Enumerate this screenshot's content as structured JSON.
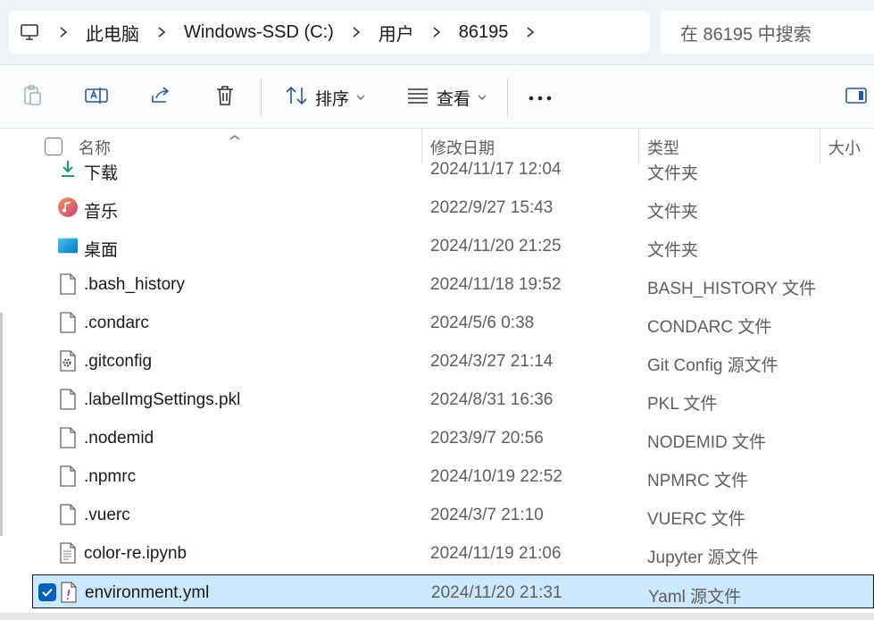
{
  "address": {
    "crumbs": [
      "此电脑",
      "Windows-SSD (C:)",
      "用户",
      "86195"
    ]
  },
  "search": {
    "placeholder": "在 86195 中搜索"
  },
  "toolbar": {
    "sort_label": "排序",
    "view_label": "查看"
  },
  "columns": {
    "name": "名称",
    "modified": "修改日期",
    "type": "类型",
    "size": "大小"
  },
  "files": [
    {
      "name": "下载",
      "modified": "2024/11/17 12:04",
      "type": "文件夹",
      "icon": "download-folder-icon",
      "selected": false
    },
    {
      "name": "音乐",
      "modified": "2022/9/27 15:43",
      "type": "文件夹",
      "icon": "music-folder-icon",
      "selected": false
    },
    {
      "name": "桌面",
      "modified": "2024/11/20 21:25",
      "type": "文件夹",
      "icon": "desktop-folder-icon",
      "selected": false
    },
    {
      "name": ".bash_history",
      "modified": "2024/11/18 19:52",
      "type": "BASH_HISTORY 文件",
      "icon": "file-icon",
      "selected": false
    },
    {
      "name": ".condarc",
      "modified": "2024/5/6 0:38",
      "type": "CONDARC 文件",
      "icon": "file-icon",
      "selected": false
    },
    {
      "name": ".gitconfig",
      "modified": "2024/3/27 21:14",
      "type": "Git Config 源文件",
      "icon": "config-file-icon",
      "selected": false
    },
    {
      "name": ".labelImgSettings.pkl",
      "modified": "2024/8/31 16:36",
      "type": "PKL 文件",
      "icon": "file-icon",
      "selected": false
    },
    {
      "name": ".nodemid",
      "modified": "2023/9/7 20:56",
      "type": "NODEMID 文件",
      "icon": "file-icon",
      "selected": false
    },
    {
      "name": ".npmrc",
      "modified": "2024/10/19 22:52",
      "type": "NPMRC 文件",
      "icon": "file-icon",
      "selected": false
    },
    {
      "name": ".vuerc",
      "modified": "2024/3/7 21:10",
      "type": "VUERC 文件",
      "icon": "file-icon",
      "selected": false
    },
    {
      "name": "color-re.ipynb",
      "modified": "2024/11/19 21:06",
      "type": "Jupyter 源文件",
      "icon": "text-file-icon",
      "selected": false
    },
    {
      "name": "environment.yml",
      "modified": "2024/11/20 21:31",
      "type": "Yaml 源文件",
      "icon": "yaml-file-icon",
      "selected": true
    }
  ],
  "colors": {
    "selection": "#cce8ff",
    "accent": "#005fb8"
  }
}
